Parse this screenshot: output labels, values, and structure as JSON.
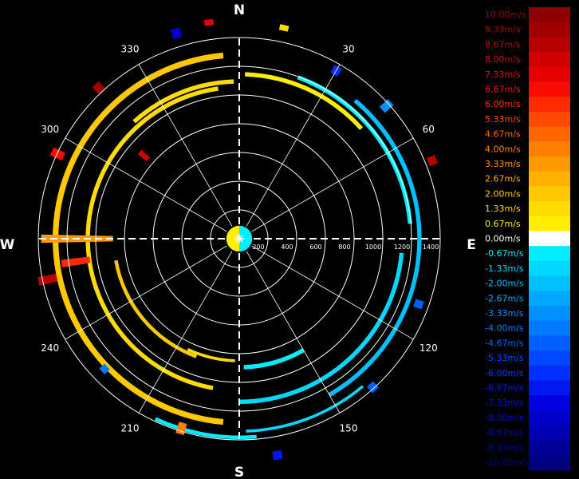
{
  "compass": {
    "north": "N",
    "east": "E",
    "south": "S",
    "west": "W"
  },
  "chart_data": {
    "type": "heatmap",
    "projection": "polar",
    "title": "",
    "azimuth_labels": [
      {
        "deg": 30,
        "text": "30"
      },
      {
        "deg": 60,
        "text": "60"
      },
      {
        "deg": 120,
        "text": "120"
      },
      {
        "deg": 150,
        "text": "150"
      },
      {
        "deg": 210,
        "text": "210"
      },
      {
        "deg": 240,
        "text": "240"
      },
      {
        "deg": 300,
        "text": "300"
      },
      {
        "deg": 330,
        "text": "330"
      }
    ],
    "range_rings": [
      200,
      400,
      600,
      800,
      1000,
      1200,
      1400
    ],
    "range_labels": [
      {
        "value": 200,
        "text": "200"
      },
      {
        "value": 400,
        "text": "400"
      },
      {
        "value": 600,
        "text": "600"
      },
      {
        "value": 800,
        "text": "800"
      },
      {
        "value": 1000,
        "text": "1000"
      },
      {
        "value": 1200,
        "text": "1200"
      },
      {
        "value": 1400,
        "text": "1400"
      }
    ],
    "range_max": 1400,
    "grid": true,
    "legend_position": "right",
    "colorbar": [
      {
        "label": "10.00m/s",
        "value": 10.0,
        "color": "#8e0000"
      },
      {
        "label": "9.33m/s",
        "value": 9.33,
        "color": "#a20000"
      },
      {
        "label": "8.67m/s",
        "value": 8.67,
        "color": "#b80000"
      },
      {
        "label": "8.00m/s",
        "value": 8.0,
        "color": "#d00000"
      },
      {
        "label": "7.33m/s",
        "value": 7.33,
        "color": "#e60000"
      },
      {
        "label": "6.67m/s",
        "value": 6.67,
        "color": "#fa0b00"
      },
      {
        "label": "6.00m/s",
        "value": 6.0,
        "color": "#ff2a00"
      },
      {
        "label": "5.33m/s",
        "value": 5.33,
        "color": "#ff4800"
      },
      {
        "label": "4.67m/s",
        "value": 4.67,
        "color": "#ff6600"
      },
      {
        "label": "4.00m/s",
        "value": 4.0,
        "color": "#ff8000"
      },
      {
        "label": "3.33m/s",
        "value": 3.33,
        "color": "#ff9900"
      },
      {
        "label": "2.67m/s",
        "value": 2.67,
        "color": "#ffb000"
      },
      {
        "label": "2.00m/s",
        "value": 2.0,
        "color": "#ffc800"
      },
      {
        "label": "1.33m/s",
        "value": 1.33,
        "color": "#ffdc00"
      },
      {
        "label": "0.67m/s",
        "value": 0.67,
        "color": "#ffee00"
      },
      {
        "label": "0.00m/s",
        "value": 0.0,
        "color": "#ffffff"
      },
      {
        "label": "-0.67m/s",
        "value": -0.67,
        "color": "#00eeff"
      },
      {
        "label": "-1.33m/s",
        "value": -1.33,
        "color": "#00d8ff"
      },
      {
        "label": "-2.00m/s",
        "value": -2.0,
        "color": "#00c0ff"
      },
      {
        "label": "-2.67m/s",
        "value": -2.67,
        "color": "#00a8ff"
      },
      {
        "label": "-3.33m/s",
        "value": -3.33,
        "color": "#0090ff"
      },
      {
        "label": "-4.00m/s",
        "value": -4.0,
        "color": "#0078ff"
      },
      {
        "label": "-4.67m/s",
        "value": -4.67,
        "color": "#0060ff"
      },
      {
        "label": "-5.33m/s",
        "value": -5.33,
        "color": "#0048ff"
      },
      {
        "label": "-6.00m/s",
        "value": -6.0,
        "color": "#0030ff"
      },
      {
        "label": "-6.67m/s",
        "value": -6.67,
        "color": "#0018f0"
      },
      {
        "label": "-7.33m/s",
        "value": -7.33,
        "color": "#0000e0"
      },
      {
        "label": "-8.00m/s",
        "value": -8.0,
        "color": "#0000c8"
      },
      {
        "label": "-8.67m/s",
        "value": -8.67,
        "color": "#0000b0"
      },
      {
        "label": "-9.33m/s",
        "value": -9.33,
        "color": "#000098"
      },
      {
        "label": "-10.00m/s",
        "value": -10.0,
        "color": "#000080"
      }
    ],
    "bands": [
      {
        "start": 318,
        "end": 358,
        "range": [
          1080,
          1110
        ],
        "value": 1.6
      },
      {
        "start": 185,
        "end": 355,
        "range": [
          1260,
          1300
        ],
        "value": 1.8
      },
      {
        "start": 190,
        "end": 352,
        "range": [
          1040,
          1070
        ],
        "value": 1.4
      },
      {
        "start": 200,
        "end": 260,
        "range": [
          860,
          885
        ],
        "value": 2.0
      },
      {
        "start": 2,
        "end": 48,
        "range": [
          1130,
          1160
        ],
        "value": 1.0
      },
      {
        "start": 20,
        "end": 85,
        "range": [
          1180,
          1210
        ],
        "value": -1.0
      },
      {
        "start": 40,
        "end": 150,
        "range": [
          1240,
          1270
        ],
        "value": -2.2
      },
      {
        "start": 95,
        "end": 180,
        "range": [
          1120,
          1150
        ],
        "value": -1.6
      },
      {
        "start": 150,
        "end": 178,
        "range": [
          880,
          910
        ],
        "value": -0.8
      },
      {
        "start": 175,
        "end": 205,
        "range": [
          1370,
          1395
        ],
        "value": -0.4
      },
      {
        "start": 140,
        "end": 178,
        "range": [
          1330,
          1350
        ],
        "value": -1.4
      },
      {
        "start": 182,
        "end": 205,
        "range": [
          840,
          860
        ],
        "value": 1.2
      },
      {
        "start": 0,
        "end": 360,
        "range": [
          0,
          90
        ],
        "value": 1.0
      }
    ],
    "gates": [
      {
        "az": 270,
        "range": [
          880,
          1380
        ],
        "value": 3.2
      },
      {
        "az": 262,
        "range": [
          1050,
          1250
        ],
        "value": 6.2
      },
      {
        "az": 258,
        "range": [
          1300,
          1430
        ],
        "value": 8.4
      },
      {
        "az": 295,
        "range": [
          1350,
          1440
        ],
        "value": 6.8
      },
      {
        "az": 317,
        "range": [
          1400,
          1470
        ],
        "value": 9.6
      },
      {
        "az": 343,
        "range": [
          1460,
          1530
        ],
        "value": -7.8
      },
      {
        "az": 352,
        "range": [
          1500,
          1540
        ],
        "value": 7.2
      },
      {
        "az": 12,
        "range": [
          1480,
          1520
        ],
        "value": 1.1
      },
      {
        "az": 30,
        "range": [
          1320,
          1380
        ],
        "value": -6.2
      },
      {
        "az": 48,
        "range": [
          1340,
          1420
        ],
        "value": -3.4
      },
      {
        "az": 68,
        "range": [
          1420,
          1480
        ],
        "value": 8.6
      },
      {
        "az": 110,
        "range": [
          1300,
          1360
        ],
        "value": -4.4
      },
      {
        "az": 138,
        "range": [
          1360,
          1420
        ],
        "value": -4.6
      },
      {
        "az": 170,
        "range": [
          1500,
          1560
        ],
        "value": -6.6
      },
      {
        "az": 197,
        "range": [
          1340,
          1420
        ],
        "value": 4.0
      },
      {
        "az": 226,
        "range": [
          1280,
          1330
        ],
        "value": -4.0
      },
      {
        "az": 311,
        "range": [
          840,
          920
        ],
        "value": 8.2
      }
    ]
  }
}
